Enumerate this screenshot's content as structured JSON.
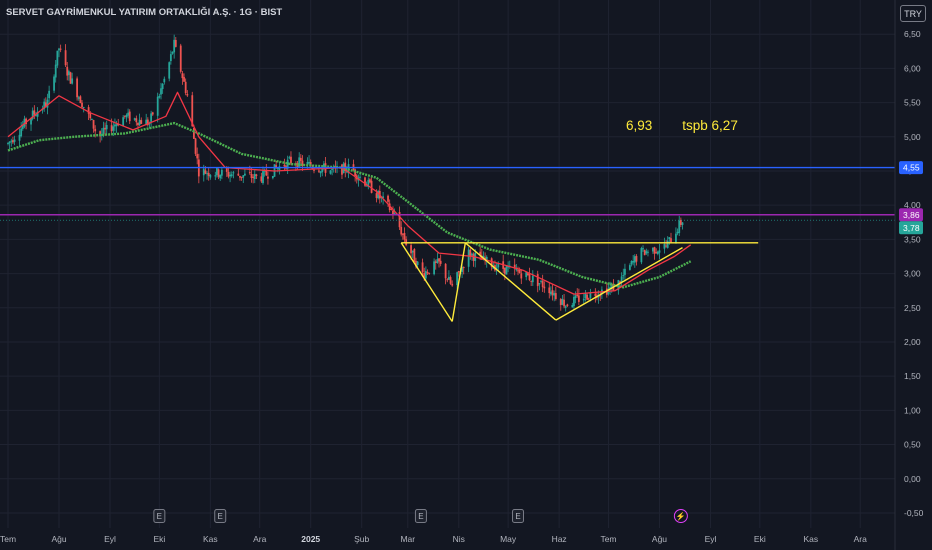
{
  "header": {
    "title": "SERVET GAYRİMENKUL YATIRIM ORTAKLIĞI A.Ş. · 1G · BIST",
    "currency": "TRY"
  },
  "annotation": {
    "text": "6,93        tspb 6,27"
  },
  "colors": {
    "background": "#131722",
    "up": "#26a69a",
    "down": "#ef5350",
    "ma_fast": "#f23645",
    "ma_slow": "#4caf50",
    "blue_line": "#2962ff",
    "purple_line": "#9c27b0",
    "pattern": "#ffeb3b"
  },
  "chart_data": {
    "type": "candlestick",
    "title": "SERVET GAYRİMENKUL YATIRIM ORTAKLIĞI A.Ş. · 1G · BIST",
    "y_ticks": [
      "6,50",
      "6,00",
      "5,50",
      "5,00",
      "4,50",
      "4,00",
      "3,50",
      "3,00",
      "2,50",
      "2,00",
      "1,50",
      "1,00",
      "0,50",
      "0,00",
      "-0,50"
    ],
    "y_tick_values": [
      6.5,
      6.0,
      5.5,
      5.0,
      4.5,
      4.0,
      3.5,
      3.0,
      2.5,
      2.0,
      1.5,
      1.0,
      0.5,
      0.0,
      -0.5
    ],
    "ylim": [
      -0.72,
      7.0
    ],
    "x_ticks": [
      {
        "label": "Tem",
        "date": "2024-07-01"
      },
      {
        "label": "Ağu",
        "date": "2024-08-01"
      },
      {
        "label": "Eyl",
        "date": "2024-09-01"
      },
      {
        "label": "Eki",
        "date": "2024-10-01"
      },
      {
        "label": "Kas",
        "date": "2024-11-01"
      },
      {
        "label": "Ara",
        "date": "2024-12-01"
      },
      {
        "label": "2025",
        "date": "2025-01-01",
        "bold": true
      },
      {
        "label": "Şub",
        "date": "2025-02-01"
      },
      {
        "label": "Mar",
        "date": "2025-03-01"
      },
      {
        "label": "Nis",
        "date": "2025-04-01"
      },
      {
        "label": "May",
        "date": "2025-05-01"
      },
      {
        "label": "Haz",
        "date": "2025-06-01"
      },
      {
        "label": "Tem",
        "date": "2025-07-01"
      },
      {
        "label": "Ağu",
        "date": "2025-08-01"
      },
      {
        "label": "Eyl",
        "date": "2025-09-01"
      },
      {
        "label": "Eki",
        "date": "2025-10-01"
      },
      {
        "label": "Kas",
        "date": "2025-11-01"
      },
      {
        "label": "Ara",
        "date": "2025-12-01"
      }
    ],
    "price_path": [
      [
        "2024-07-01",
        4.9
      ],
      [
        "2024-07-15",
        5.3
      ],
      [
        "2024-07-25",
        5.5
      ],
      [
        "2024-08-01",
        6.3
      ],
      [
        "2024-08-05",
        6.0
      ],
      [
        "2024-08-15",
        5.5
      ],
      [
        "2024-08-25",
        5.0
      ],
      [
        "2024-09-10",
        5.3
      ],
      [
        "2024-09-25",
        5.2
      ],
      [
        "2024-10-05",
        5.9
      ],
      [
        "2024-10-10",
        6.35
      ],
      [
        "2024-10-18",
        5.6
      ],
      [
        "2024-10-25",
        4.5
      ],
      [
        "2024-11-15",
        4.45
      ],
      [
        "2024-12-01",
        4.4
      ],
      [
        "2024-12-20",
        4.65
      ],
      [
        "2025-01-15",
        4.5
      ],
      [
        "2025-01-25",
        4.55
      ],
      [
        "2025-02-05",
        4.3
      ],
      [
        "2025-02-20",
        3.9
      ],
      [
        "2025-03-01",
        3.4
      ],
      [
        "2025-03-10",
        3.0
      ],
      [
        "2025-03-20",
        3.15
      ],
      [
        "2025-03-28",
        2.8
      ],
      [
        "2025-04-07",
        3.3
      ],
      [
        "2025-04-15",
        3.2
      ],
      [
        "2025-04-25",
        3.1
      ],
      [
        "2025-05-10",
        3.0
      ],
      [
        "2025-05-25",
        2.8
      ],
      [
        "2025-06-05",
        2.55
      ],
      [
        "2025-06-20",
        2.7
      ],
      [
        "2025-07-05",
        2.8
      ],
      [
        "2025-07-20",
        3.3
      ],
      [
        "2025-08-05",
        3.4
      ],
      [
        "2025-08-15",
        3.78
      ]
    ],
    "ma_fast_path": [
      [
        "2024-07-01",
        5.0
      ],
      [
        "2024-08-01",
        5.6
      ],
      [
        "2024-08-20",
        5.35
      ],
      [
        "2024-09-15",
        5.1
      ],
      [
        "2024-10-05",
        5.3
      ],
      [
        "2024-10-12",
        5.65
      ],
      [
        "2024-10-25",
        5.0
      ],
      [
        "2024-11-10",
        4.55
      ],
      [
        "2024-12-10",
        4.5
      ],
      [
        "2025-01-20",
        4.55
      ],
      [
        "2025-02-10",
        4.2
      ],
      [
        "2025-03-01",
        3.7
      ],
      [
        "2025-03-20",
        3.3
      ],
      [
        "2025-04-10",
        3.25
      ],
      [
        "2025-05-10",
        3.05
      ],
      [
        "2025-06-10",
        2.7
      ],
      [
        "2025-07-05",
        2.75
      ],
      [
        "2025-07-25",
        3.05
      ],
      [
        "2025-08-10",
        3.25
      ],
      [
        "2025-08-20",
        3.42
      ]
    ],
    "ma_slow_path": [
      [
        "2024-07-01",
        4.8
      ],
      [
        "2024-07-20",
        4.95
      ],
      [
        "2024-08-10",
        5.0
      ],
      [
        "2024-09-10",
        5.05
      ],
      [
        "2024-10-10",
        5.2
      ],
      [
        "2024-10-25",
        5.05
      ],
      [
        "2024-11-20",
        4.75
      ],
      [
        "2024-12-20",
        4.6
      ],
      [
        "2025-01-20",
        4.55
      ],
      [
        "2025-02-10",
        4.4
      ],
      [
        "2025-03-01",
        4.05
      ],
      [
        "2025-03-25",
        3.6
      ],
      [
        "2025-04-20",
        3.35
      ],
      [
        "2025-05-20",
        3.2
      ],
      [
        "2025-06-15",
        2.95
      ],
      [
        "2025-07-10",
        2.8
      ],
      [
        "2025-08-01",
        2.95
      ],
      [
        "2025-08-20",
        3.18
      ]
    ],
    "horizontal_lines": [
      {
        "value": 4.55,
        "label": "4,55",
        "color": "#2962ff"
      },
      {
        "value": 3.86,
        "label": "3,86",
        "color": "#9c27b0"
      }
    ],
    "price_tag": {
      "value": 3.78,
      "label": "3,78",
      "color": "#26a69a"
    },
    "pattern_segments": [
      {
        "from": [
          "2025-02-25",
          3.45
        ],
        "to": [
          "2025-04-05",
          3.45
        ]
      },
      {
        "from": [
          "2025-04-05",
          3.45
        ],
        "to": [
          "2025-09-30",
          3.45
        ]
      },
      {
        "from": [
          "2025-02-25",
          3.45
        ],
        "to": [
          "2025-03-28",
          2.3
        ]
      },
      {
        "from": [
          "2025-03-28",
          2.3
        ],
        "to": [
          "2025-04-05",
          3.45
        ]
      },
      {
        "from": [
          "2025-04-05",
          3.45
        ],
        "to": [
          "2025-05-30",
          2.32
        ]
      },
      {
        "from": [
          "2025-05-30",
          2.32
        ],
        "to": [
          "2025-08-15",
          3.38
        ]
      }
    ],
    "events": [
      {
        "date": "2024-10-01",
        "label": "E"
      },
      {
        "date": "2024-11-07",
        "label": "E"
      },
      {
        "date": "2025-03-09",
        "label": "E"
      },
      {
        "date": "2025-05-07",
        "label": "E"
      },
      {
        "date": "2025-08-14",
        "label": "⚡"
      }
    ]
  }
}
